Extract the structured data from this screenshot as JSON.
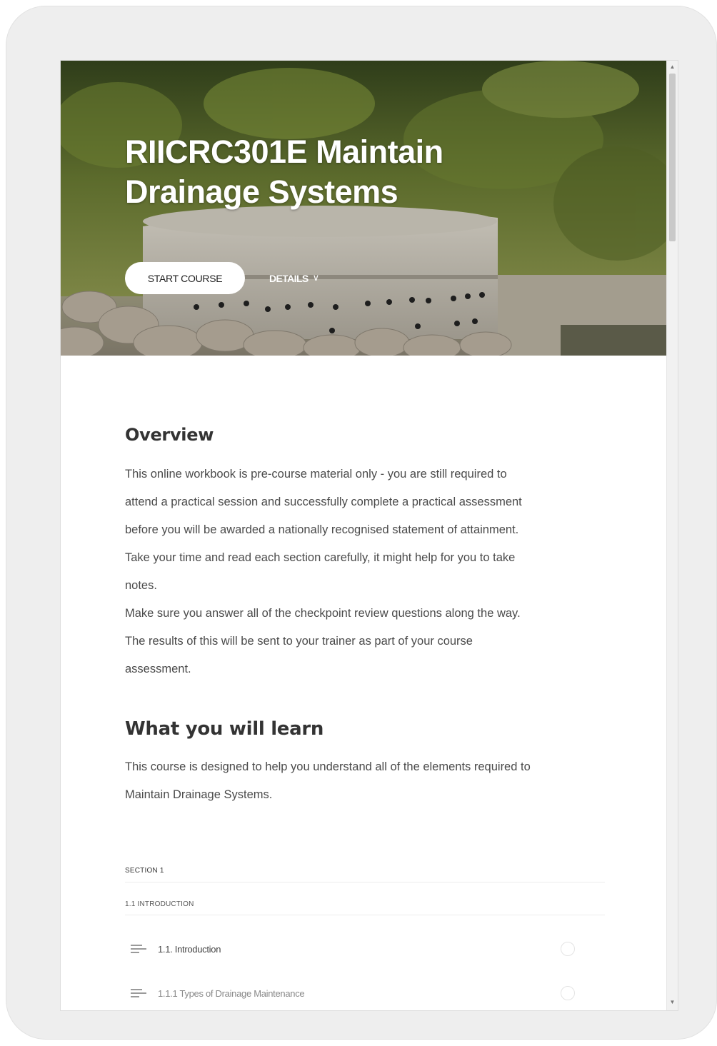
{
  "course": {
    "title_line1": "RIICRC301E Maintain",
    "title_line2": "Drainage Systems",
    "start_label": "START COURSE",
    "details_label": "DETAILS",
    "details_icon": "chevron-down-icon"
  },
  "overview": {
    "heading": "Overview",
    "lines": [
      "This online workbook is pre-course material only - you are still required to",
      "attend a practical session and successfully complete a practical assessment",
      "before you will be awarded a nationally recognised statement of attainment.",
      "Take your time and read each section carefully, it might help for you to take",
      "notes.",
      "Make sure you answer all of the checkpoint review questions along the way.",
      "The results of this will be sent to your trainer as part of your course",
      "assessment."
    ]
  },
  "learn": {
    "heading": "What you will learn",
    "lines": [
      "This course is designed to help you understand all of the elements required to",
      "Maintain Drainage Systems."
    ]
  },
  "outline": {
    "section_label": "SECTION 1",
    "subsection_label": "1.1 INTRODUCTION",
    "lessons": [
      {
        "title": "1.1. Introduction",
        "icon": "text-lines-icon"
      },
      {
        "title": "1.1.1 Types of Drainage Maintenance",
        "icon": "text-lines-icon"
      }
    ]
  },
  "colors": {
    "device_frame": "#eeeeee",
    "start_button_bg": "#ffffff",
    "heading_text": "#333333",
    "body_text": "#4a4a4a"
  }
}
